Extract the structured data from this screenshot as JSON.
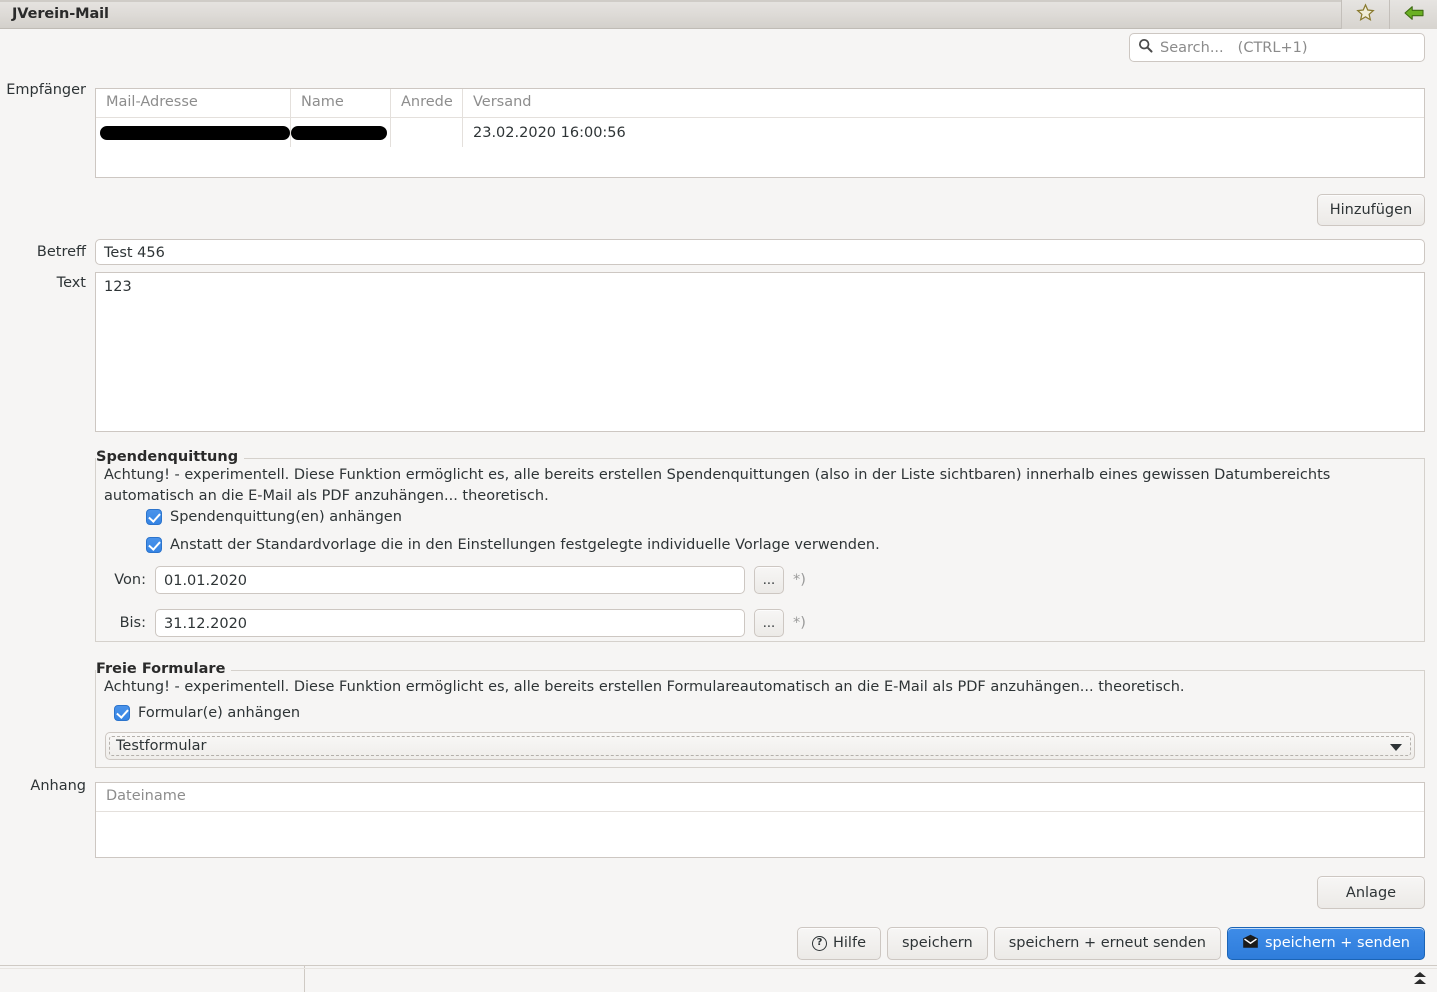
{
  "window": {
    "title": "JVerein-Mail",
    "titlebar_buttons": [
      {
        "name": "favorite-star-icon",
        "label": "☆"
      },
      {
        "name": "back-arrow-icon",
        "label": "←"
      }
    ]
  },
  "search": {
    "placeholder": "Search...",
    "shortcut": "(CTRL+1)",
    "icon": "search-icon"
  },
  "form": {
    "recipients_label": "Empfänger",
    "subject_label": "Betreff",
    "subject_value": "Test 456",
    "text_label": "Text",
    "text_value": "123",
    "attachment_label": "Anhang"
  },
  "recipients_table": {
    "columns": [
      "Mail-Adresse",
      "Name",
      "Anrede",
      "Versand"
    ],
    "rows": [
      {
        "mail": "",
        "name": "",
        "anrede": "",
        "versand": "23.02.2020 16:00:56",
        "redacted": true
      }
    ],
    "add_button": "Hinzufügen"
  },
  "spendenquittung": {
    "title": "Spendenquittung",
    "description": "Achtung! - experimentell. Diese Funktion ermöglicht es, alle bereits erstellen Spendenquittungen (also in der Liste sichtbaren) innerhalb eines gewissen Datumbereichts automatisch an die E-Mail als PDF anzuhängen... theoretisch.",
    "checkbox_attach_label": "Spendenquittung(en) anhängen",
    "checkbox_attach_checked": true,
    "checkbox_template_label": "Anstatt der Standardvorlage die in den Einstellungen festgelegte individuelle Vorlage verwenden.",
    "checkbox_template_checked": true,
    "from_label": "Von:",
    "from_value": "01.01.2020",
    "to_label": "Bis:",
    "to_value": "31.12.2020",
    "picker_button": "...",
    "required_note": "*)"
  },
  "freie_formulare": {
    "title": "Freie Formulare",
    "description": "Achtung! - experimentell. Diese Funktion ermöglicht es, alle bereits erstellen Formulareautomatisch an die E-Mail als PDF anzuhängen... theoretisch.",
    "checkbox_label": "Formular(e) anhängen",
    "checkbox_checked": true,
    "selected_form": "Testformular"
  },
  "attachment_table": {
    "columns": [
      "Dateiname"
    ],
    "rows": []
  },
  "buttons": {
    "anlage": "Anlage",
    "hilfe": "Hilfe",
    "speichern": "speichern",
    "speichern_erneut_senden": "speichern + erneut senden",
    "speichern_senden": "speichern + senden"
  },
  "colors": {
    "accent_blue": "#3584e4",
    "window_background": "#f6f5f4",
    "border": "#cdc7c2",
    "placeholder_text": "#8d8d8d"
  },
  "statusbar": {
    "panel_left": "",
    "panel_right": ""
  }
}
